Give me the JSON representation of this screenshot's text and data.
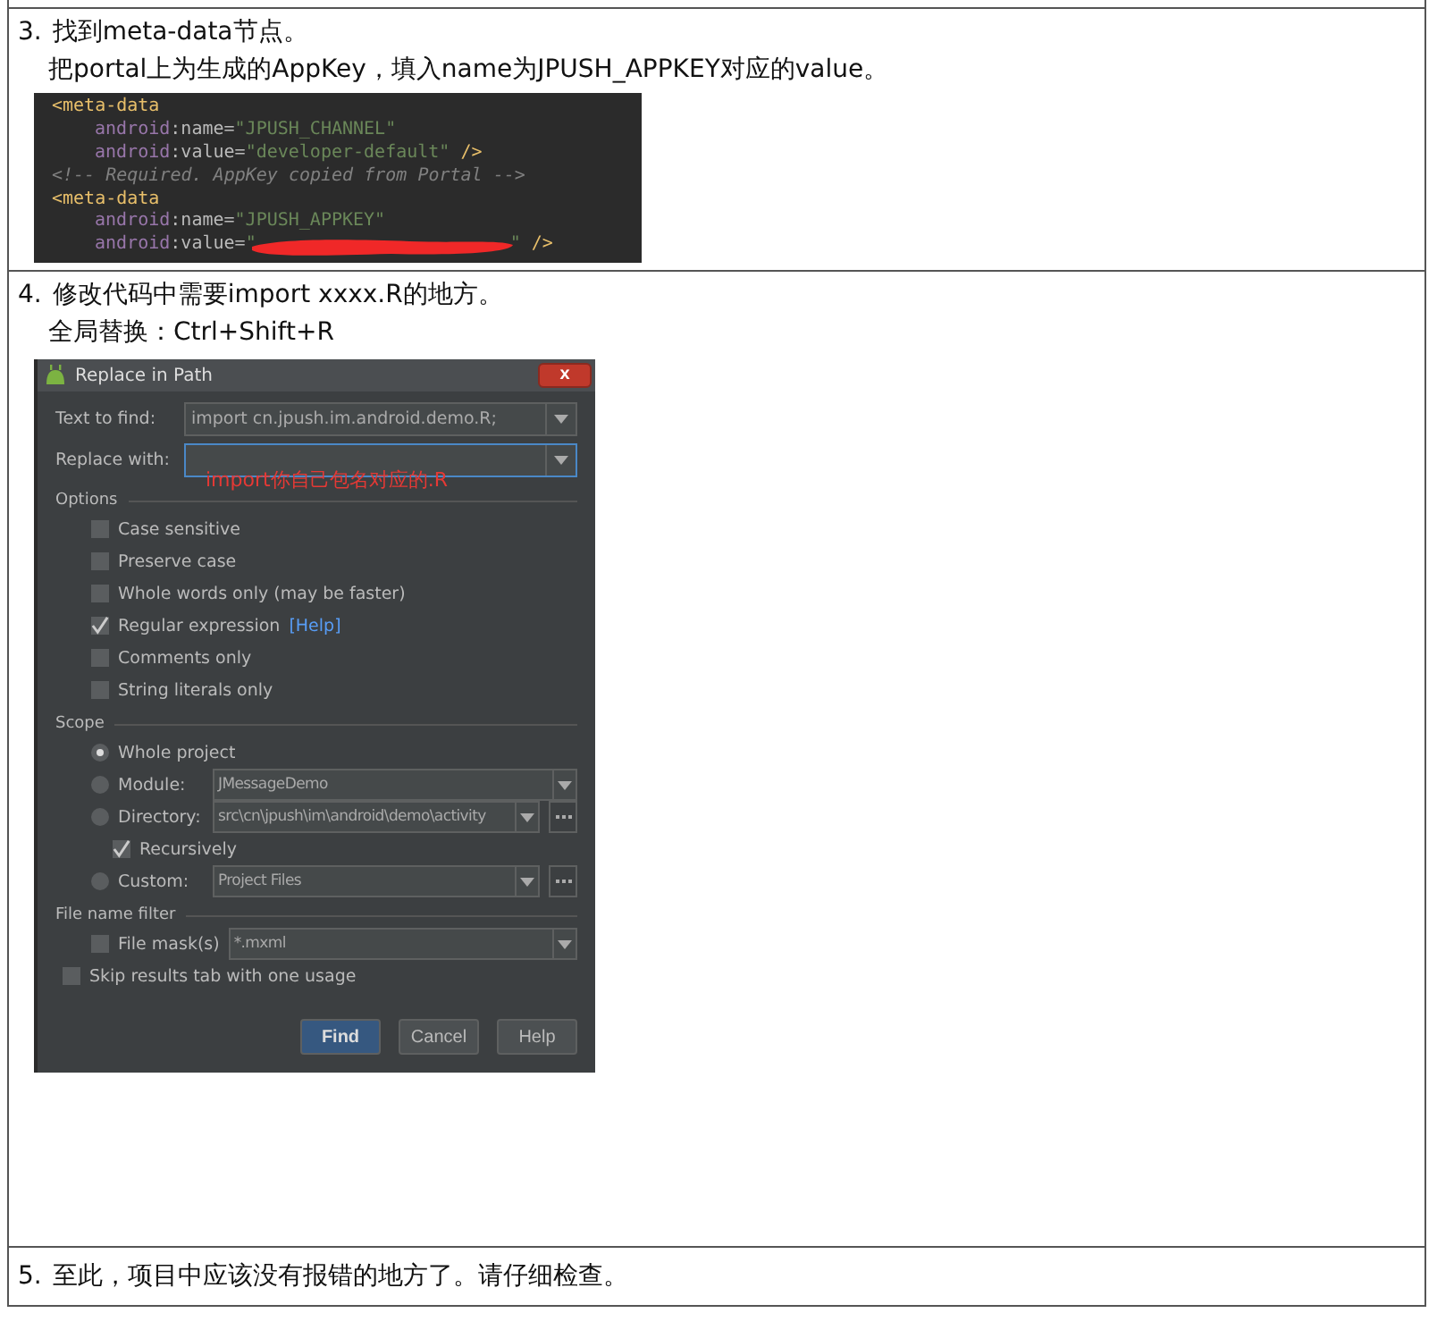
{
  "steps": [
    {
      "number": "3.",
      "title": "找到meta-data节点。",
      "lines": [
        "把portal上为生成的AppKey，填入name为JPUSH_APPKEY对应的value。"
      ],
      "code": {
        "lines": [
          [
            {
              "kind": "tag",
              "text": "<meta-data"
            }
          ],
          [
            {
              "kind": "attr",
              "text": "android",
              "indent": true
            },
            {
              "kind": "plain",
              "text": ":name="
            },
            {
              "kind": "string",
              "text": "\"JPUSH_CHANNEL\""
            }
          ],
          [
            {
              "kind": "attr",
              "text": "android",
              "indent": true
            },
            {
              "kind": "plain",
              "text": ":value="
            },
            {
              "kind": "string",
              "text": "\"developer-default\""
            },
            {
              "kind": "tag",
              "text": " />"
            }
          ],
          [
            {
              "kind": "comment",
              "text": "<!-- Required. AppKey copied from Portal -->"
            }
          ],
          [
            {
              "kind": "tag",
              "text": "<meta-data"
            }
          ],
          [
            {
              "kind": "attr",
              "text": "android",
              "indent": true
            },
            {
              "kind": "plain",
              "text": ":name="
            },
            {
              "kind": "string",
              "text": "\"JPUSH_APPKEY\""
            }
          ],
          [
            {
              "kind": "attr",
              "text": "android",
              "indent": true
            },
            {
              "kind": "plain",
              "text": ":value="
            },
            {
              "kind": "string",
              "text": "\""
            },
            {
              "kind": "redacted"
            },
            {
              "kind": "string",
              "text": "\""
            },
            {
              "kind": "tag",
              "text": " />"
            }
          ]
        ]
      }
    },
    {
      "number": "4.",
      "title": "修改代码中需要import  xxxx.R的地方。",
      "lines": [
        "全局替换：Ctrl+Shift+R"
      ],
      "dialog": {
        "title": "Replace in Path",
        "close": "x",
        "fields": [
          {
            "label": "Text to find:",
            "value": "import cn.jpush.im.android.demo.R;",
            "focused": false
          },
          {
            "label": "Replace with:",
            "focused": true,
            "annotation": "import你自己包名对应的.R"
          }
        ],
        "sections": [
          {
            "title": "Options",
            "items": [
              {
                "kind": "checkbox",
                "label": "Case sensitive",
                "checked": false
              },
              {
                "kind": "checkbox",
                "label": "Preserve case",
                "checked": false
              },
              {
                "kind": "checkbox",
                "label": "Whole words only (may be faster)",
                "checked": false
              },
              {
                "kind": "checkbox",
                "label": "Regular expression",
                "checked": true,
                "link": "[Help]"
              },
              {
                "kind": "checkbox",
                "label": "Comments only",
                "checked": false
              },
              {
                "kind": "checkbox",
                "label": "String literals only",
                "checked": false
              }
            ]
          },
          {
            "title": "Scope",
            "items": [
              {
                "kind": "radio",
                "label": "Whole project",
                "selected": true
              },
              {
                "kind": "radio",
                "label": "Module:",
                "selected": false,
                "combo": "JMessageDemo"
              },
              {
                "kind": "radio",
                "label": "Directory:",
                "selected": false,
                "combo": "src\\cn\\jpush\\im\\android\\demo\\activity",
                "browse": true
              },
              {
                "kind": "subcheckbox",
                "label": "Recursively",
                "checked": true
              },
              {
                "kind": "radio",
                "label": "Custom:",
                "selected": false,
                "combo": "Project Files",
                "browse": true
              }
            ]
          },
          {
            "title": "File name filter",
            "items": [
              {
                "kind": "checkbox",
                "label": "File mask(s)",
                "checked": false,
                "combo": "*.mxml"
              }
            ]
          }
        ],
        "skip": {
          "label": "Skip results tab with one usage",
          "checked": false
        },
        "buttons": [
          {
            "label": "Find",
            "default": true
          },
          {
            "label": "Cancel",
            "default": false
          },
          {
            "label": "Help",
            "default": false
          }
        ]
      }
    },
    {
      "number": "5.",
      "title": "至此，项目中应该没有报错的地方了。请仔细检查。"
    }
  ]
}
